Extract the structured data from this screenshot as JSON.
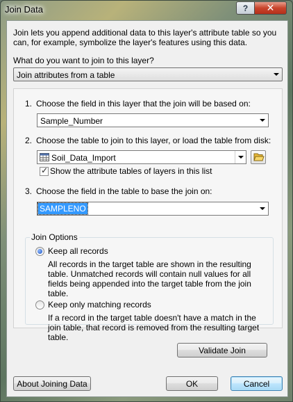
{
  "window": {
    "title": "Join Data"
  },
  "titlebar": {
    "help_label": "?",
    "close_label": "✕"
  },
  "intro": "Join lets you append additional data to this layer's attribute table so you can, for example, symbolize the layer's features using this data.",
  "question": "What do you want to join to this layer?",
  "join_type": {
    "value": "Join attributes from a table"
  },
  "step1": {
    "number": "1.",
    "label": "Choose the field in this layer that the join will be based on:",
    "value": "Sample_Number"
  },
  "step2": {
    "number": "2.",
    "label": "Choose the table to join to this layer, or load the table from disk:",
    "value": "Soil_Data_Import",
    "table_icon": "table-icon",
    "browse_icon": "open-folder-icon",
    "checkbox_label": "Show the attribute tables of layers in this list",
    "checkbox_checked": true
  },
  "step3": {
    "number": "3.",
    "label": "Choose the field in the table to base the join on:",
    "value": "SAMPLENO"
  },
  "join_options": {
    "legend": "Join Options",
    "keep_all": {
      "label": "Keep all records",
      "selected": true,
      "description": "All records in the target table are shown in the resulting table. Unmatched records will contain null values for all fields being appended into the target table from the join table."
    },
    "keep_matching": {
      "label": "Keep only matching records",
      "selected": false,
      "description": "If a record in the target table doesn't have a match in the join table, that record is removed from the resulting target table."
    }
  },
  "buttons": {
    "validate": "Validate Join",
    "about": "About Joining Data",
    "ok": "OK",
    "cancel": "Cancel"
  },
  "colors": {
    "selection": "#3399ff",
    "dialog_bg": "#f0f0f0",
    "close_button": "#c8442c"
  }
}
